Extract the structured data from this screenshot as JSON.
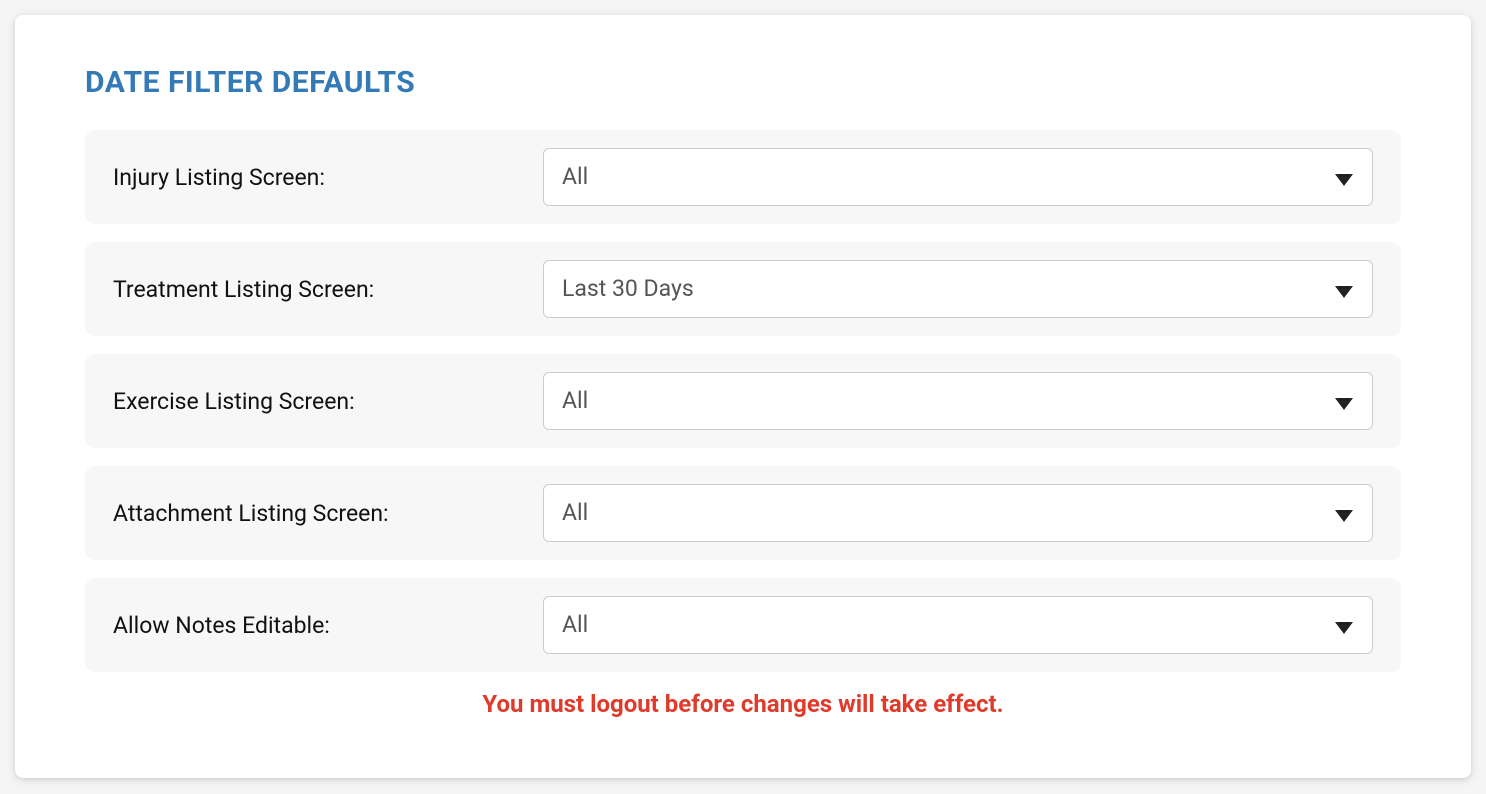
{
  "section": {
    "title": "DATE FILTER DEFAULTS",
    "warning": "You must logout before changes will take effect.",
    "rows": [
      {
        "label": "Injury Listing Screen:",
        "value": "All"
      },
      {
        "label": "Treatment Listing Screen:",
        "value": "Last 30 Days"
      },
      {
        "label": "Exercise Listing Screen:",
        "value": "All"
      },
      {
        "label": "Attachment Listing Screen:",
        "value": "All"
      },
      {
        "label": "Allow Notes Editable:",
        "value": "All"
      }
    ]
  }
}
